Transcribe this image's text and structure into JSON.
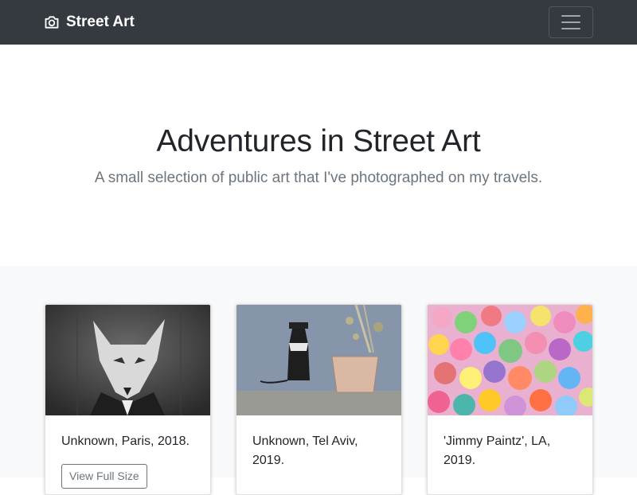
{
  "navbar": {
    "brand": "Street Art",
    "brand_icon": "camera-icon",
    "toggler_icon": "hamburger-menu-icon"
  },
  "jumbotron": {
    "title": "Adventures in Street Art",
    "lead": "A small selection of public art that I've photographed on my travels."
  },
  "cards": [
    {
      "caption": "Unknown, Paris, 2018.",
      "button": "View Full Size",
      "image": "wolf-in-suit-mural"
    },
    {
      "caption": "Unknown, Tel Aviv, 2019.",
      "image": "rat-and-planter-mural"
    },
    {
      "caption": "'Jimmy Paintz', LA, 2019.",
      "image": "colorful-smiley-faces-mural"
    }
  ],
  "colors": {
    "navbar_bg": "#343a40",
    "album_bg": "#f8f9fa",
    "muted_text": "#6c757d"
  }
}
